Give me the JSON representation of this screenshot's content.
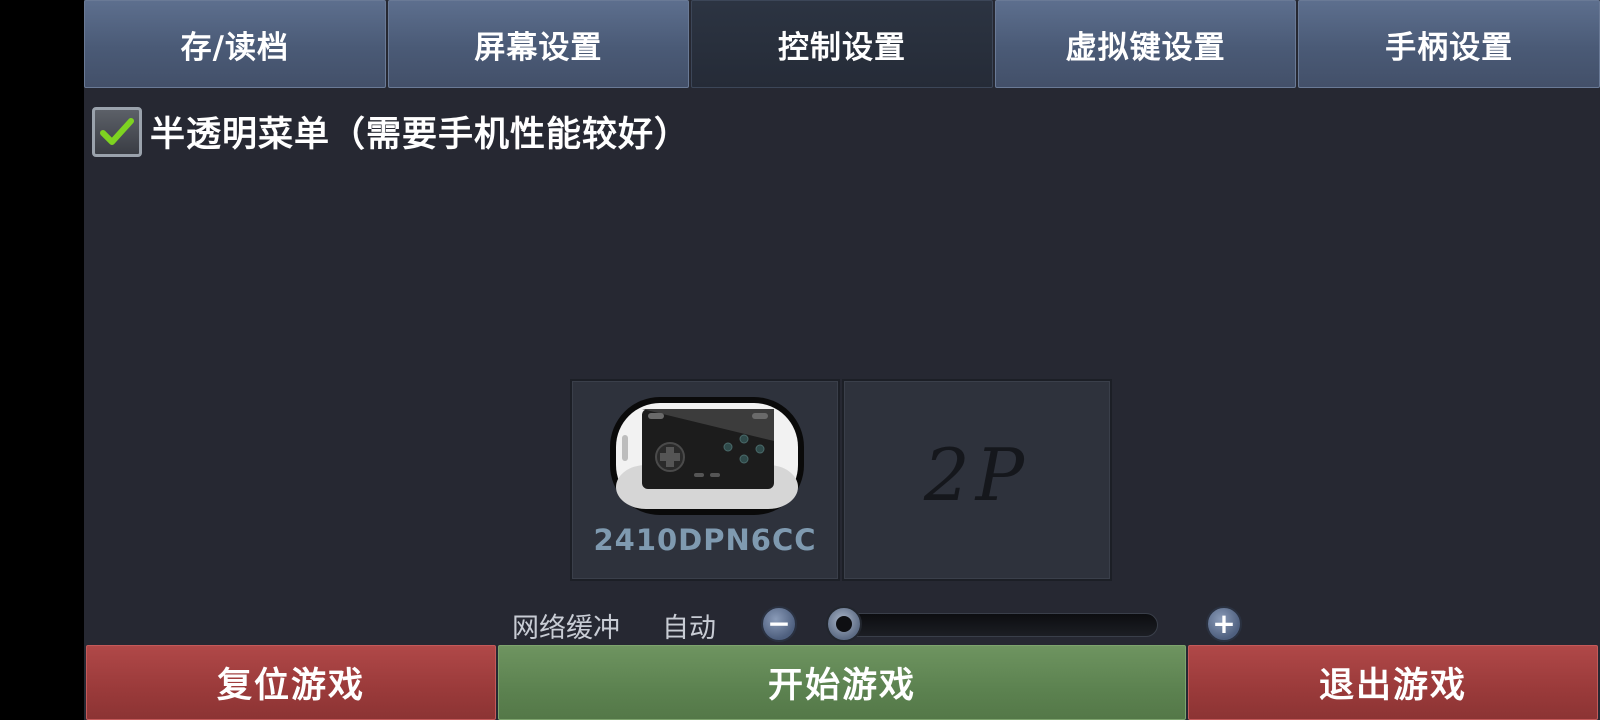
{
  "tabs": [
    {
      "label": "存/读档",
      "active": false
    },
    {
      "label": "屏幕设置",
      "active": false
    },
    {
      "label": "控制设置",
      "active": true
    },
    {
      "label": "虚拟键设置",
      "active": false
    },
    {
      "label": "手柄设置",
      "active": false
    }
  ],
  "options": {
    "translucent_menu": {
      "label": "半透明菜单（需要手机性能较好）",
      "checked": true
    }
  },
  "players": {
    "p1": {
      "name": "2410DPN6CC",
      "icon": "gamepad-icon"
    },
    "p2": {
      "label": "2P"
    }
  },
  "network_buffer": {
    "label": "网络缓冲",
    "value": "自动",
    "minus_symbol": "−",
    "plus_symbol": "+",
    "slider_level": 0
  },
  "actions": {
    "reset_label": "复位游戏",
    "start_label": "开始游戏",
    "exit_label": "退出游戏"
  },
  "colors": {
    "background": "#262832",
    "tab": "#4a5a76",
    "tab_active": "#252b37",
    "reset": "#9a3a3a",
    "start": "#5c8250",
    "exit": "#9a3a3a",
    "check": "#7ed321",
    "player_name": "#7f9ab0"
  }
}
